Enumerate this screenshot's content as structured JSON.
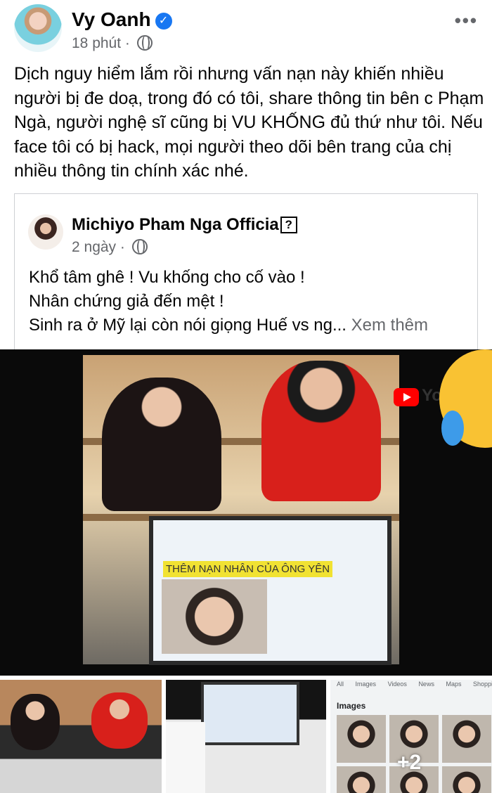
{
  "post": {
    "author": "Vy Oanh",
    "time": "18 phút",
    "separator": "·",
    "text": "Dịch nguy hiểm lắm rồi nhưng vấn nạn này khiến nhiều người bị đe doạ, trong đó có tôi, share thông tin bên c Phạm Ngà, người nghệ sĩ cũng bị VU KHỐNG đủ thứ như tôi. Nếu face tôi có bị hack, mọi người theo dõi bên trang của chị nhiều thông tin chính xác nhé.",
    "more_icon": "•••"
  },
  "shared_post": {
    "author": "Michiyo Pham Nga Officia",
    "unknown_glyph": "?",
    "time": "2 ngày",
    "separator": "·",
    "lines": [
      "Khổ tâm ghê ! Vu khống cho cố vào !",
      "Nhân chứng giả đến mệt !",
      "Sinh ra ở Mỹ lại còn nói giọng Huế vs ng..."
    ],
    "see_more": "Xem thêm"
  },
  "media": {
    "monitor_caption": "THÊM NẠN NHÂN CỦA ÔNG YÊN",
    "watermark": "You",
    "more_count": "+2",
    "search_tabs": [
      "All",
      "Images",
      "Videos",
      "News",
      "Maps",
      "Shopping"
    ],
    "search_images_title": "Images"
  },
  "colors": {
    "verified": "#1877f2",
    "meta": "#65676b",
    "youtube": "#ff0000",
    "emoji": "#f9c233"
  }
}
